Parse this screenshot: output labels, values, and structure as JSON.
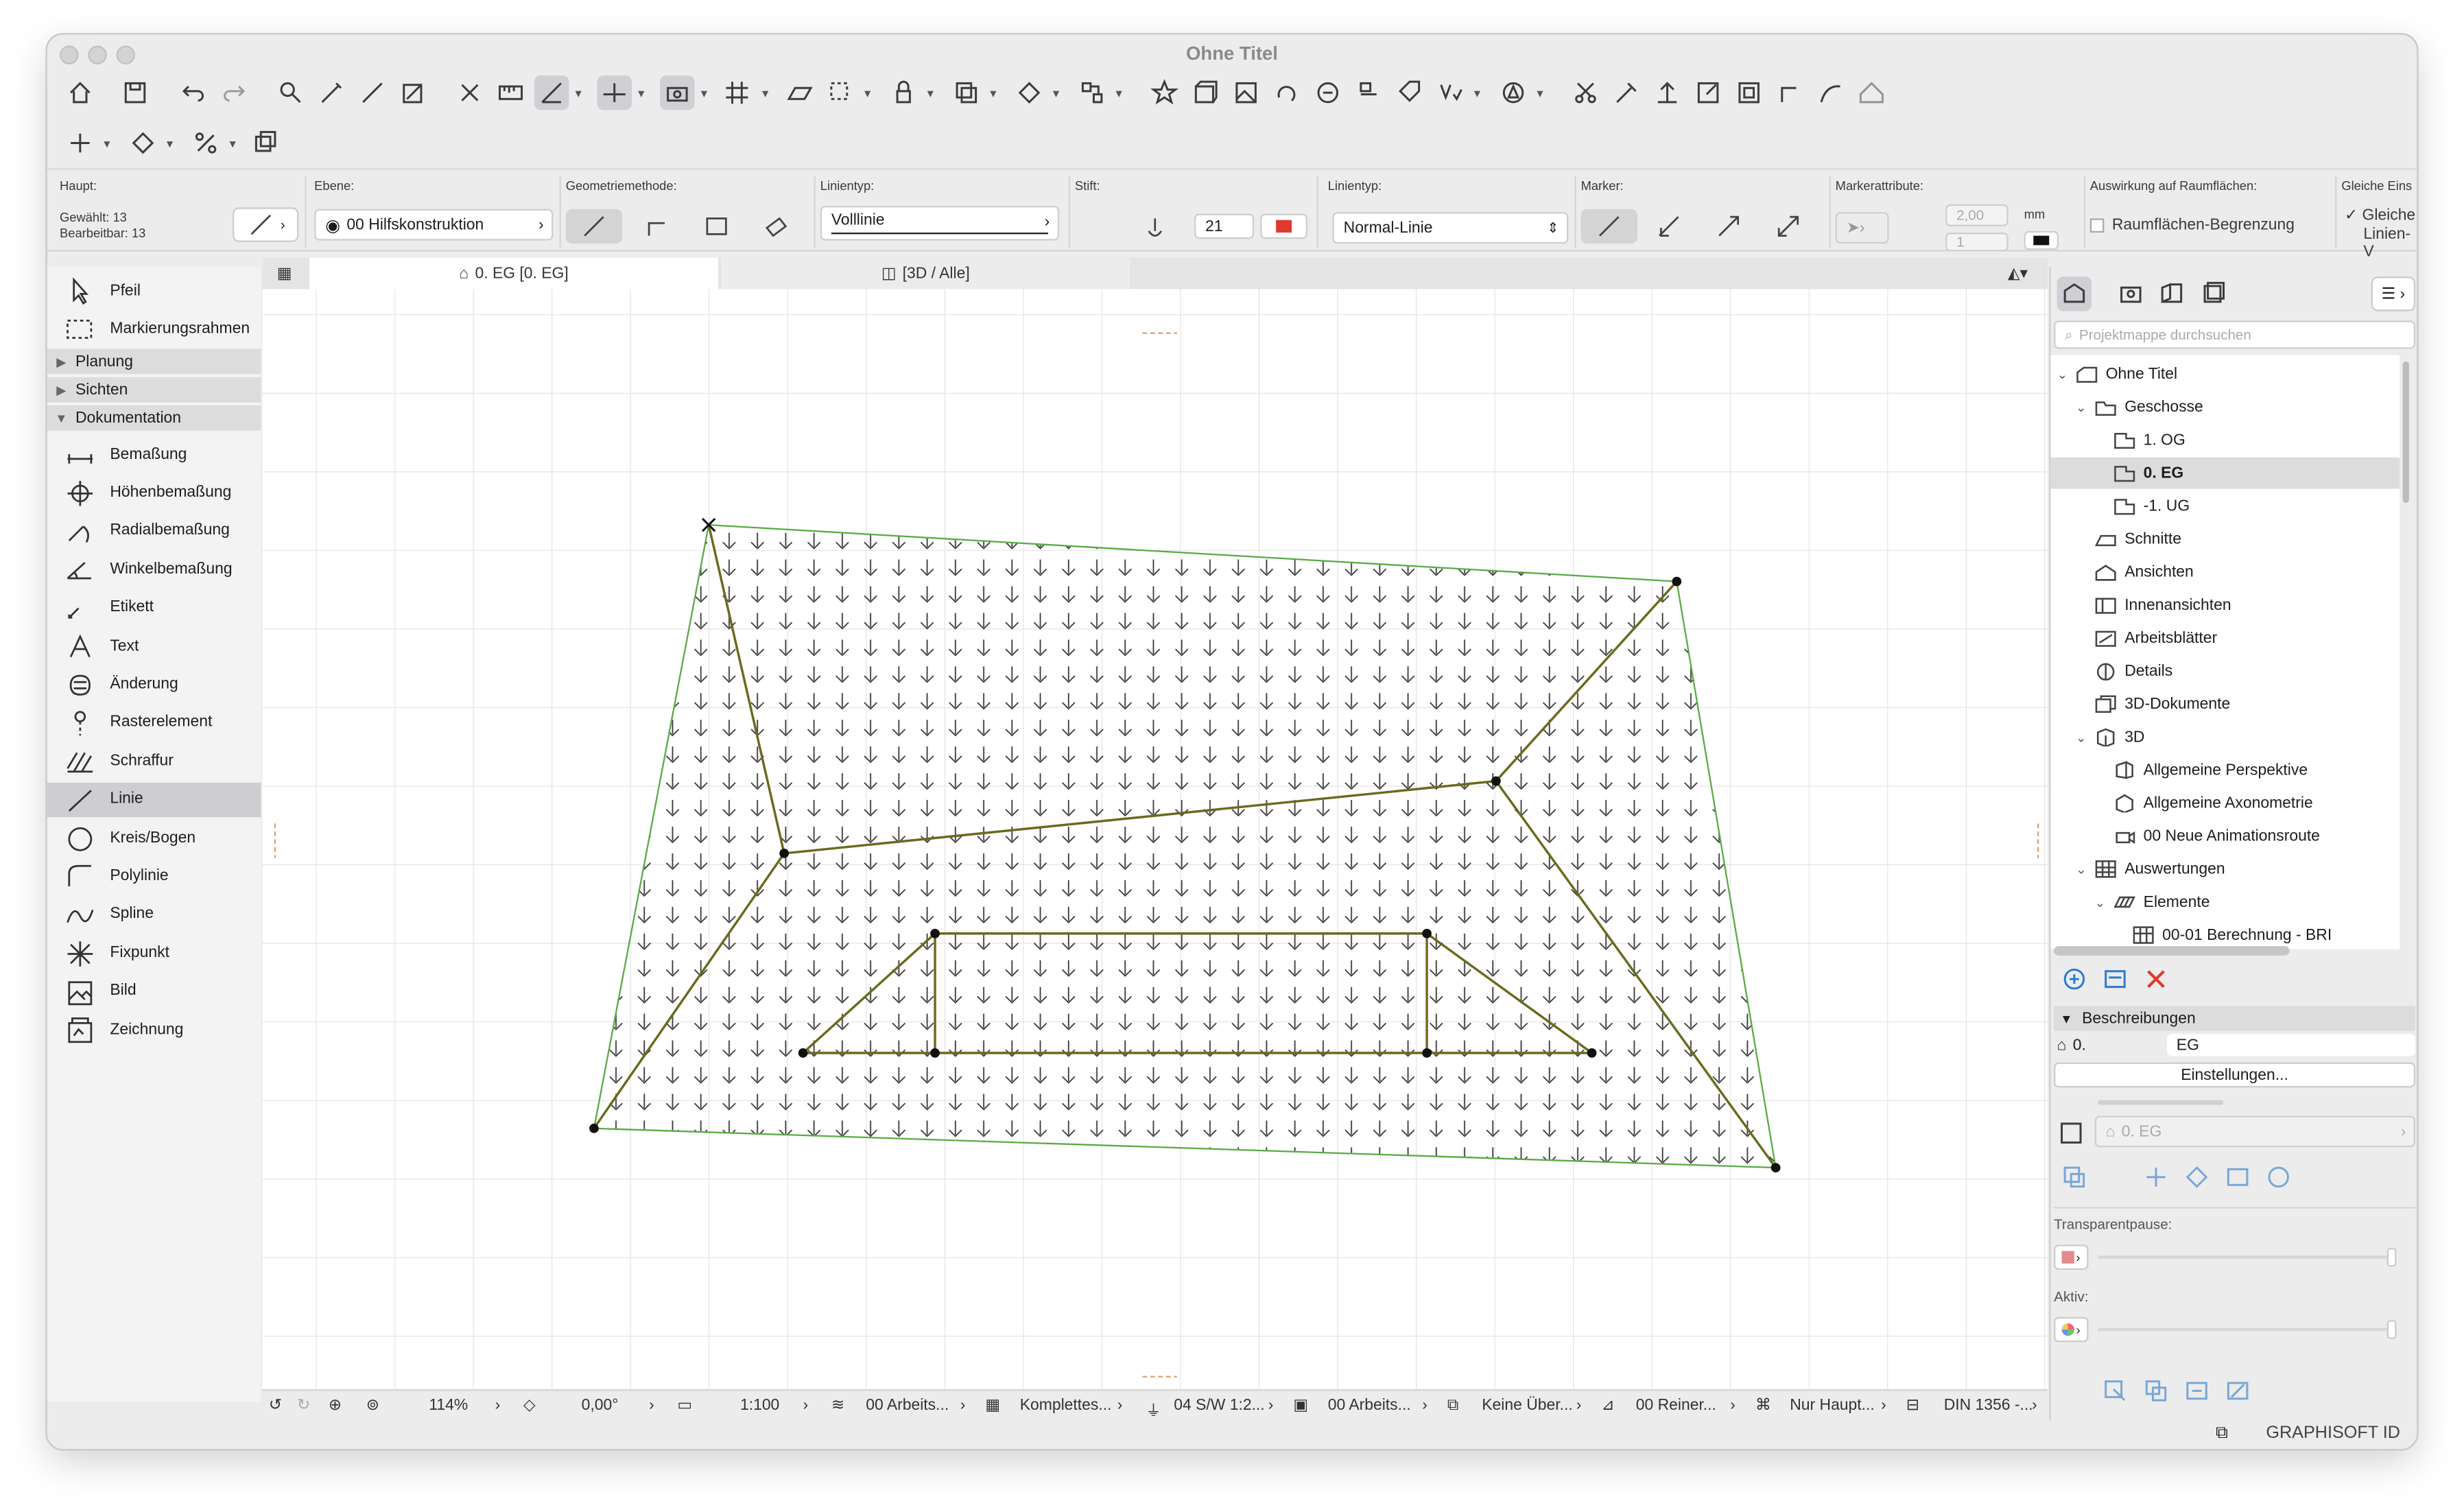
{
  "window": {
    "title": "Ohne Titel"
  },
  "infobox": {
    "haupt_label": "Haupt:",
    "selected": "Gewählt: 13",
    "editable": "Bearbeitbar: 13",
    "ebene_label": "Ebene:",
    "ebene_value": "00 Hilfskonstruktion",
    "geometrie_label": "Geometriemethode:",
    "linientyp_label": "Linientyp:",
    "linientyp_value": "Volllinie",
    "stift_label": "Stift:",
    "stift_value": "21",
    "linientyp2_label": "Linientyp:",
    "linientyp2_value": "Normal-Linie",
    "marker_label": "Marker:",
    "markerattr_label": "Markerattribute:",
    "marker_size": "2,00",
    "marker_unit": "mm",
    "marker_pen": "1",
    "raum_label": "Auswirkung auf Raumflächen:",
    "raum_value": "Raumflächen-Begrenzung",
    "gleich_label": "Gleiche Eins",
    "gleich_value1": "Gleiche",
    "gleich_value2": "Linien-V",
    "pen_color": "#e03a2f"
  },
  "toolbox": {
    "top_tools": [
      "Pfeil",
      "Markierungsrahmen"
    ],
    "groups": [
      "Planung",
      "Sichten",
      "Dokumentation"
    ],
    "doc_tools": [
      "Bemaßung",
      "Höhenbemaßung",
      "Radialbemaßung",
      "Winkelbemaßung",
      "Etikett",
      "Text",
      "Änderung",
      "Rasterelement",
      "Schraffur",
      "Linie",
      "Kreis/Bogen",
      "Polylinie",
      "Spline",
      "Fixpunkt",
      "Bild",
      "Zeichnung"
    ],
    "selected": "Linie"
  },
  "tabs": [
    {
      "label": "0. EG [0. EG]",
      "active": true
    },
    {
      "label": "[3D / Alle]",
      "active": false
    }
  ],
  "statusbar": {
    "zoom": "114%",
    "angle": "0,00°",
    "scale": "1:100",
    "layer_combo": "00 Arbeits...",
    "model_view": "Komplettes...",
    "pen_set": "04 S/W 1:2...",
    "graphic": "00 Arbeits...",
    "override": "Keine Über...",
    "renovation": "00 Reiner...",
    "structure": "Nur Haupt...",
    "dimension": "DIN 1356 -..."
  },
  "navigator": {
    "search_placeholder": "Projektmappe durchsuchen",
    "tree": [
      {
        "label": "Ohne Titel",
        "level": 0,
        "icon": "project-icon",
        "open": true
      },
      {
        "label": "Geschosse",
        "level": 1,
        "icon": "stories-icon",
        "open": true
      },
      {
        "label": "1. OG",
        "level": 2,
        "icon": "story-icon"
      },
      {
        "label": "0. EG",
        "level": 2,
        "icon": "story-icon",
        "selected": true
      },
      {
        "label": "-1. UG",
        "level": 2,
        "icon": "story-icon"
      },
      {
        "label": "Schnitte",
        "level": 1,
        "icon": "section-icon"
      },
      {
        "label": "Ansichten",
        "level": 1,
        "icon": "elevation-icon"
      },
      {
        "label": "Innenansichten",
        "level": 1,
        "icon": "interior-elevation-icon"
      },
      {
        "label": "Arbeitsblätter",
        "level": 1,
        "icon": "worksheet-icon"
      },
      {
        "label": "Details",
        "level": 1,
        "icon": "detail-icon"
      },
      {
        "label": "3D-Dokumente",
        "level": 1,
        "icon": "3d-document-icon"
      },
      {
        "label": "3D",
        "level": 1,
        "icon": "3d-icon",
        "open": true
      },
      {
        "label": "Allgemeine Perspektive",
        "level": 2,
        "icon": "perspective-icon"
      },
      {
        "label": "Allgemeine Axonometrie",
        "level": 2,
        "icon": "axonometry-icon"
      },
      {
        "label": "00 Neue Animationsroute",
        "level": 2,
        "icon": "camera-icon"
      },
      {
        "label": "Auswertungen",
        "level": 1,
        "icon": "schedule-icon",
        "open": true
      },
      {
        "label": "Elemente",
        "level": 2,
        "icon": "elements-icon",
        "open": true
      },
      {
        "label": "00-01 Berechnung - BRI",
        "level": 3,
        "icon": "table-icon"
      }
    ],
    "beschreibungen": "Beschreibungen",
    "story_num": "0.",
    "story_name": "EG",
    "settings_btn": "Einstellungen...",
    "view_ref": "0. EG",
    "transparent_label": "Transparentpause:",
    "aktiv_label": "Aktiv:"
  },
  "footer": {
    "brand": "GRAPHISOFT ID"
  },
  "colors": {
    "hatch_outline": "#5aaa46",
    "ridge_line": "#6b6a1e",
    "accent": "#e03a2f"
  }
}
